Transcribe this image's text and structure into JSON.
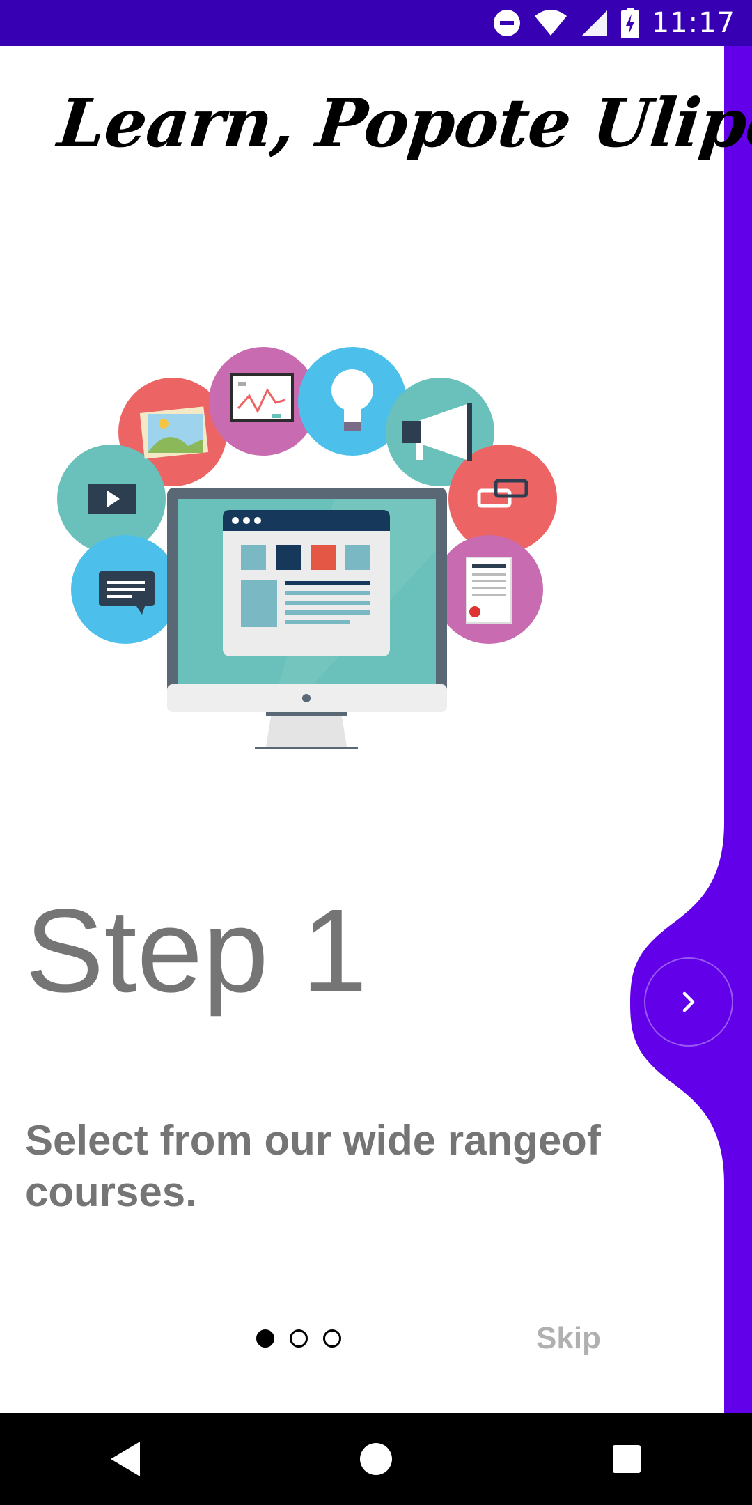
{
  "status_bar": {
    "time": "11:17",
    "icons": [
      "do-not-disturb-icon",
      "wifi-icon",
      "signal-icon",
      "battery-charging-icon"
    ]
  },
  "header": {
    "title": "Learn, Popote Ulipo!"
  },
  "onboarding": {
    "step_title": "Step 1",
    "step_description": "Select from our wide rangeof courses.",
    "pages_total": 3,
    "current_page": 1,
    "skip_label": "Skip",
    "next_icon": "chevron-right-icon"
  },
  "colors": {
    "status_bar": "#3700b3",
    "accent": "#6200ea",
    "text_muted": "#757575",
    "skip": "#b0b0b0"
  },
  "navigation": {
    "buttons": [
      "back-icon",
      "home-icon",
      "recents-icon"
    ]
  }
}
